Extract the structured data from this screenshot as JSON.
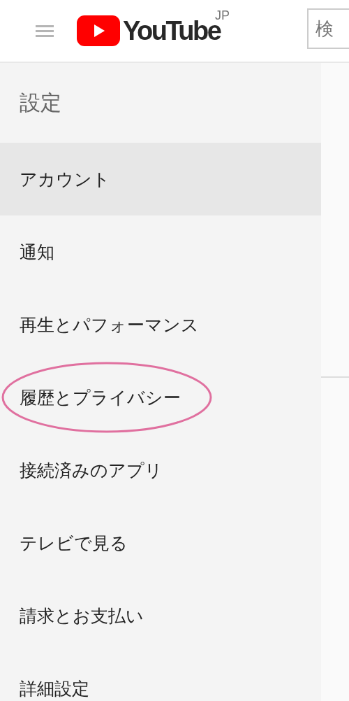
{
  "header": {
    "logo": {
      "wordmark": "YouTube",
      "region": "JP"
    },
    "search": {
      "placeholder": "検"
    }
  },
  "sidebar": {
    "title": "設定",
    "items": [
      {
        "label": "アカウント",
        "selected": true,
        "highlighted": false
      },
      {
        "label": "通知",
        "selected": false,
        "highlighted": false
      },
      {
        "label": "再生とパフォーマンス",
        "selected": false,
        "highlighted": false
      },
      {
        "label": "履歴とプライバシー",
        "selected": false,
        "highlighted": true
      },
      {
        "label": "接続済みのアプリ",
        "selected": false,
        "highlighted": false
      },
      {
        "label": "テレビで見る",
        "selected": false,
        "highlighted": false
      },
      {
        "label": "請求とお支払い",
        "selected": false,
        "highlighted": false
      },
      {
        "label": "詳細設定",
        "selected": false,
        "highlighted": false
      }
    ]
  }
}
